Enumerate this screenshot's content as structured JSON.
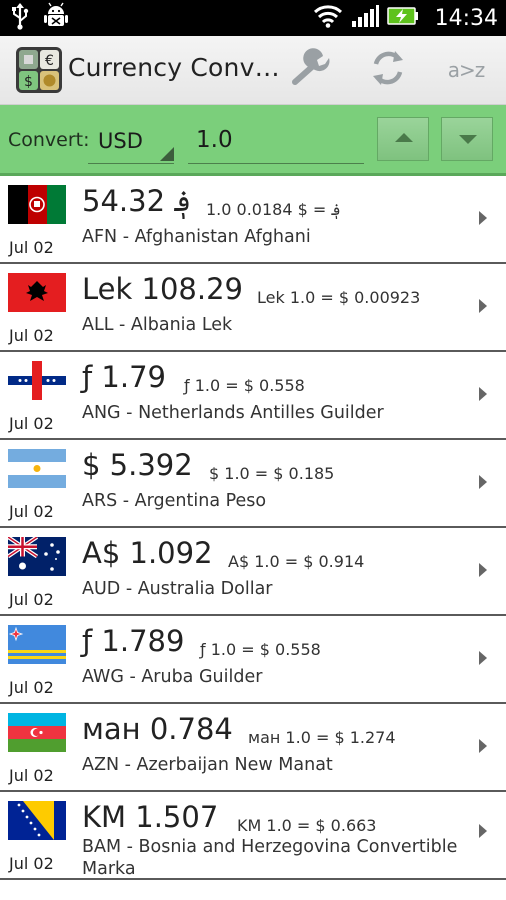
{
  "status_bar": {
    "time": "14:34"
  },
  "action_bar": {
    "title": "Currency Conv…",
    "sort_label": "a>z"
  },
  "convert_bar": {
    "label": "Convert:",
    "currency": "USD",
    "amount": "1.0"
  },
  "rows": [
    {
      "code_name": "AFN - Afghanistan Afghani",
      "amount": "54.32 ؋",
      "rate": "1.0 ؋ = $ 0.0184",
      "date": "Jul 02",
      "flag": "afghanistan-flag"
    },
    {
      "code_name": "ALL - Albania Lek",
      "amount": "Lek 108.29",
      "rate": "Lek 1.0 = $ 0.00923",
      "date": "Jul 02",
      "flag": "albania-flag"
    },
    {
      "code_name": "ANG - Netherlands Antilles Guilder",
      "amount": "ƒ 1.79",
      "rate": "ƒ 1.0 = $ 0.558",
      "date": "Jul 02",
      "flag": "netherlands-antilles-flag"
    },
    {
      "code_name": "ARS - Argentina Peso",
      "amount": "$ 5.392",
      "rate": "$ 1.0 = $ 0.185",
      "date": "Jul 02",
      "flag": "argentina-flag"
    },
    {
      "code_name": "AUD - Australia Dollar",
      "amount": "A$ 1.092",
      "rate": "A$ 1.0 = $ 0.914",
      "date": "Jul 02",
      "flag": "australia-flag"
    },
    {
      "code_name": "AWG - Aruba Guilder",
      "amount": "ƒ 1.789",
      "rate": "ƒ 1.0 = $ 0.558",
      "date": "Jul 02",
      "flag": "aruba-flag"
    },
    {
      "code_name": "AZN - Azerbaijan New Manat",
      "amount": "ман 0.784",
      "rate": "ман 1.0 = $ 1.274",
      "date": "Jul 02",
      "flag": "azerbaijan-flag"
    },
    {
      "code_name": "BAM - Bosnia and Herzegovina Convertible Marka",
      "amount": "KM 1.507",
      "rate": "KM 1.0 = $ 0.663",
      "date": "Jul 02",
      "flag": "bosnia-flag"
    }
  ]
}
